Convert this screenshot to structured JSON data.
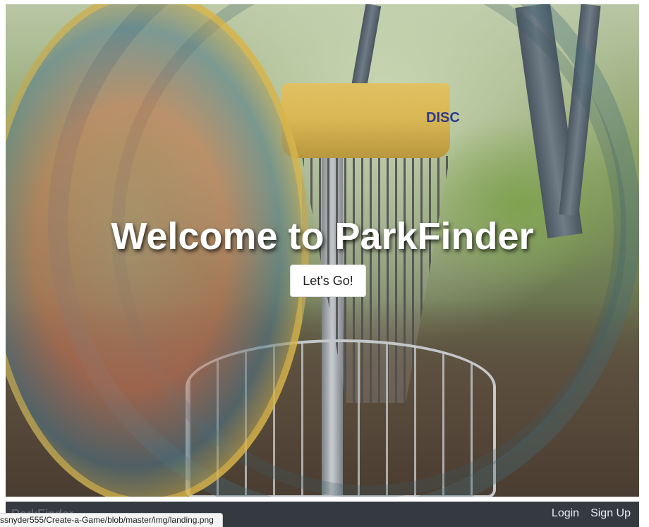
{
  "hero": {
    "title": "Welcome to ParkFinder",
    "cta_label": "Let's Go!",
    "basket_brand": "DISC"
  },
  "navbar": {
    "brand": "ParkFinder",
    "links": [
      "Login",
      "Sign Up"
    ]
  },
  "status_bar": {
    "url": "ssnyder555/Create-a-Game/blob/master/img/landing.png"
  },
  "colors": {
    "navbar_bg": "#343a40",
    "title_text": "#ffffff",
    "button_bg": "#ffffff"
  }
}
